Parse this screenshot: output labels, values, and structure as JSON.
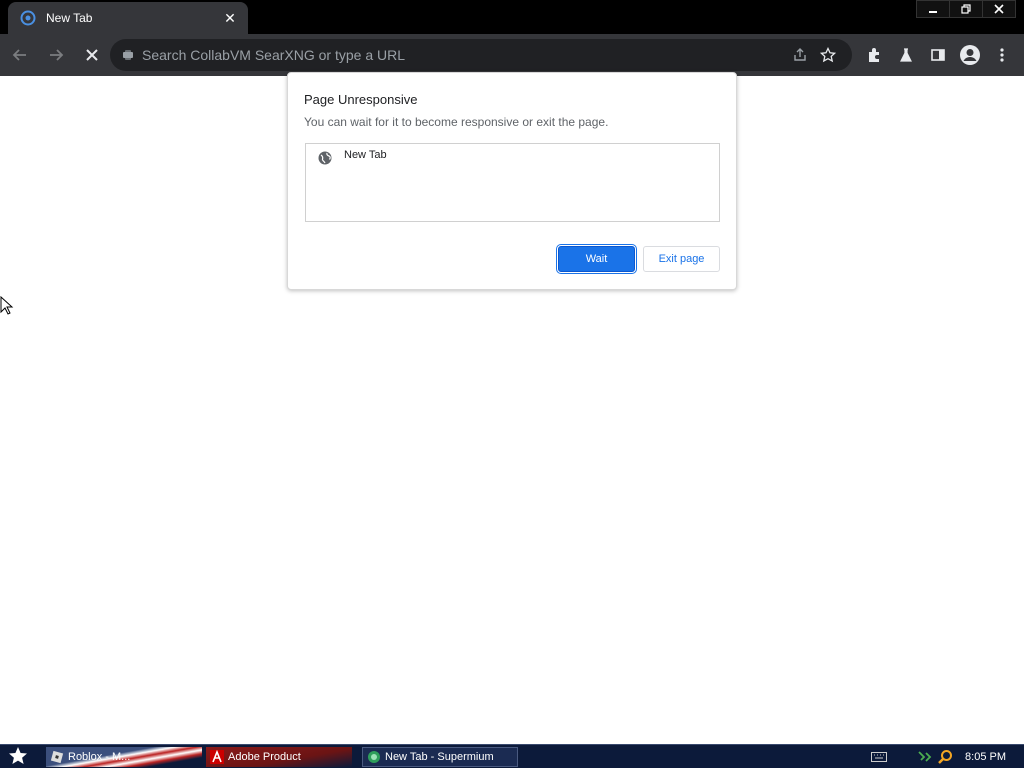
{
  "browser": {
    "tab": {
      "title": "New Tab",
      "favicon": "supermium-icon",
      "close": "close-icon"
    },
    "window_controls": [
      "minimize-icon",
      "restore-icon",
      "close-icon"
    ],
    "toolbar": {
      "back_icon": "back-arrow-icon",
      "forward_icon": "forward-arrow-icon",
      "stop_icon": "stop-icon",
      "omnibox": {
        "placeholder": "Search CollabVM SearXNG or type a URL",
        "value": ""
      },
      "icons": [
        "share-icon",
        "star-icon",
        "extensions-icon",
        "labs-icon",
        "side-panel-icon",
        "profile-icon",
        "menu-icon"
      ]
    }
  },
  "dialog": {
    "title": "Page Unresponsive",
    "message": "You can wait for it to become responsive or exit the page.",
    "pages": [
      {
        "label": "New Tab",
        "icon": "globe-icon"
      }
    ],
    "wait_label": "Wait",
    "exit_label": "Exit page"
  },
  "taskbar": {
    "start_icon": "star-icon",
    "items": [
      {
        "label": "Roblox - M...",
        "icon": "roblox-icon"
      },
      {
        "label": "Adobe Product",
        "icon": "adobe-icon"
      },
      {
        "label": "New Tab - Supermium",
        "icon": "supermium-icon"
      }
    ],
    "tray_icons": [
      "keyboard-icon",
      "network-icon",
      "search-icon"
    ],
    "clock": "8:05 PM"
  },
  "colors": {
    "accent": "#1a73e8",
    "toolbar_bg": "#35363a",
    "omnibox_bg": "#202124",
    "taskbar_bg": "#0c1a3a"
  }
}
